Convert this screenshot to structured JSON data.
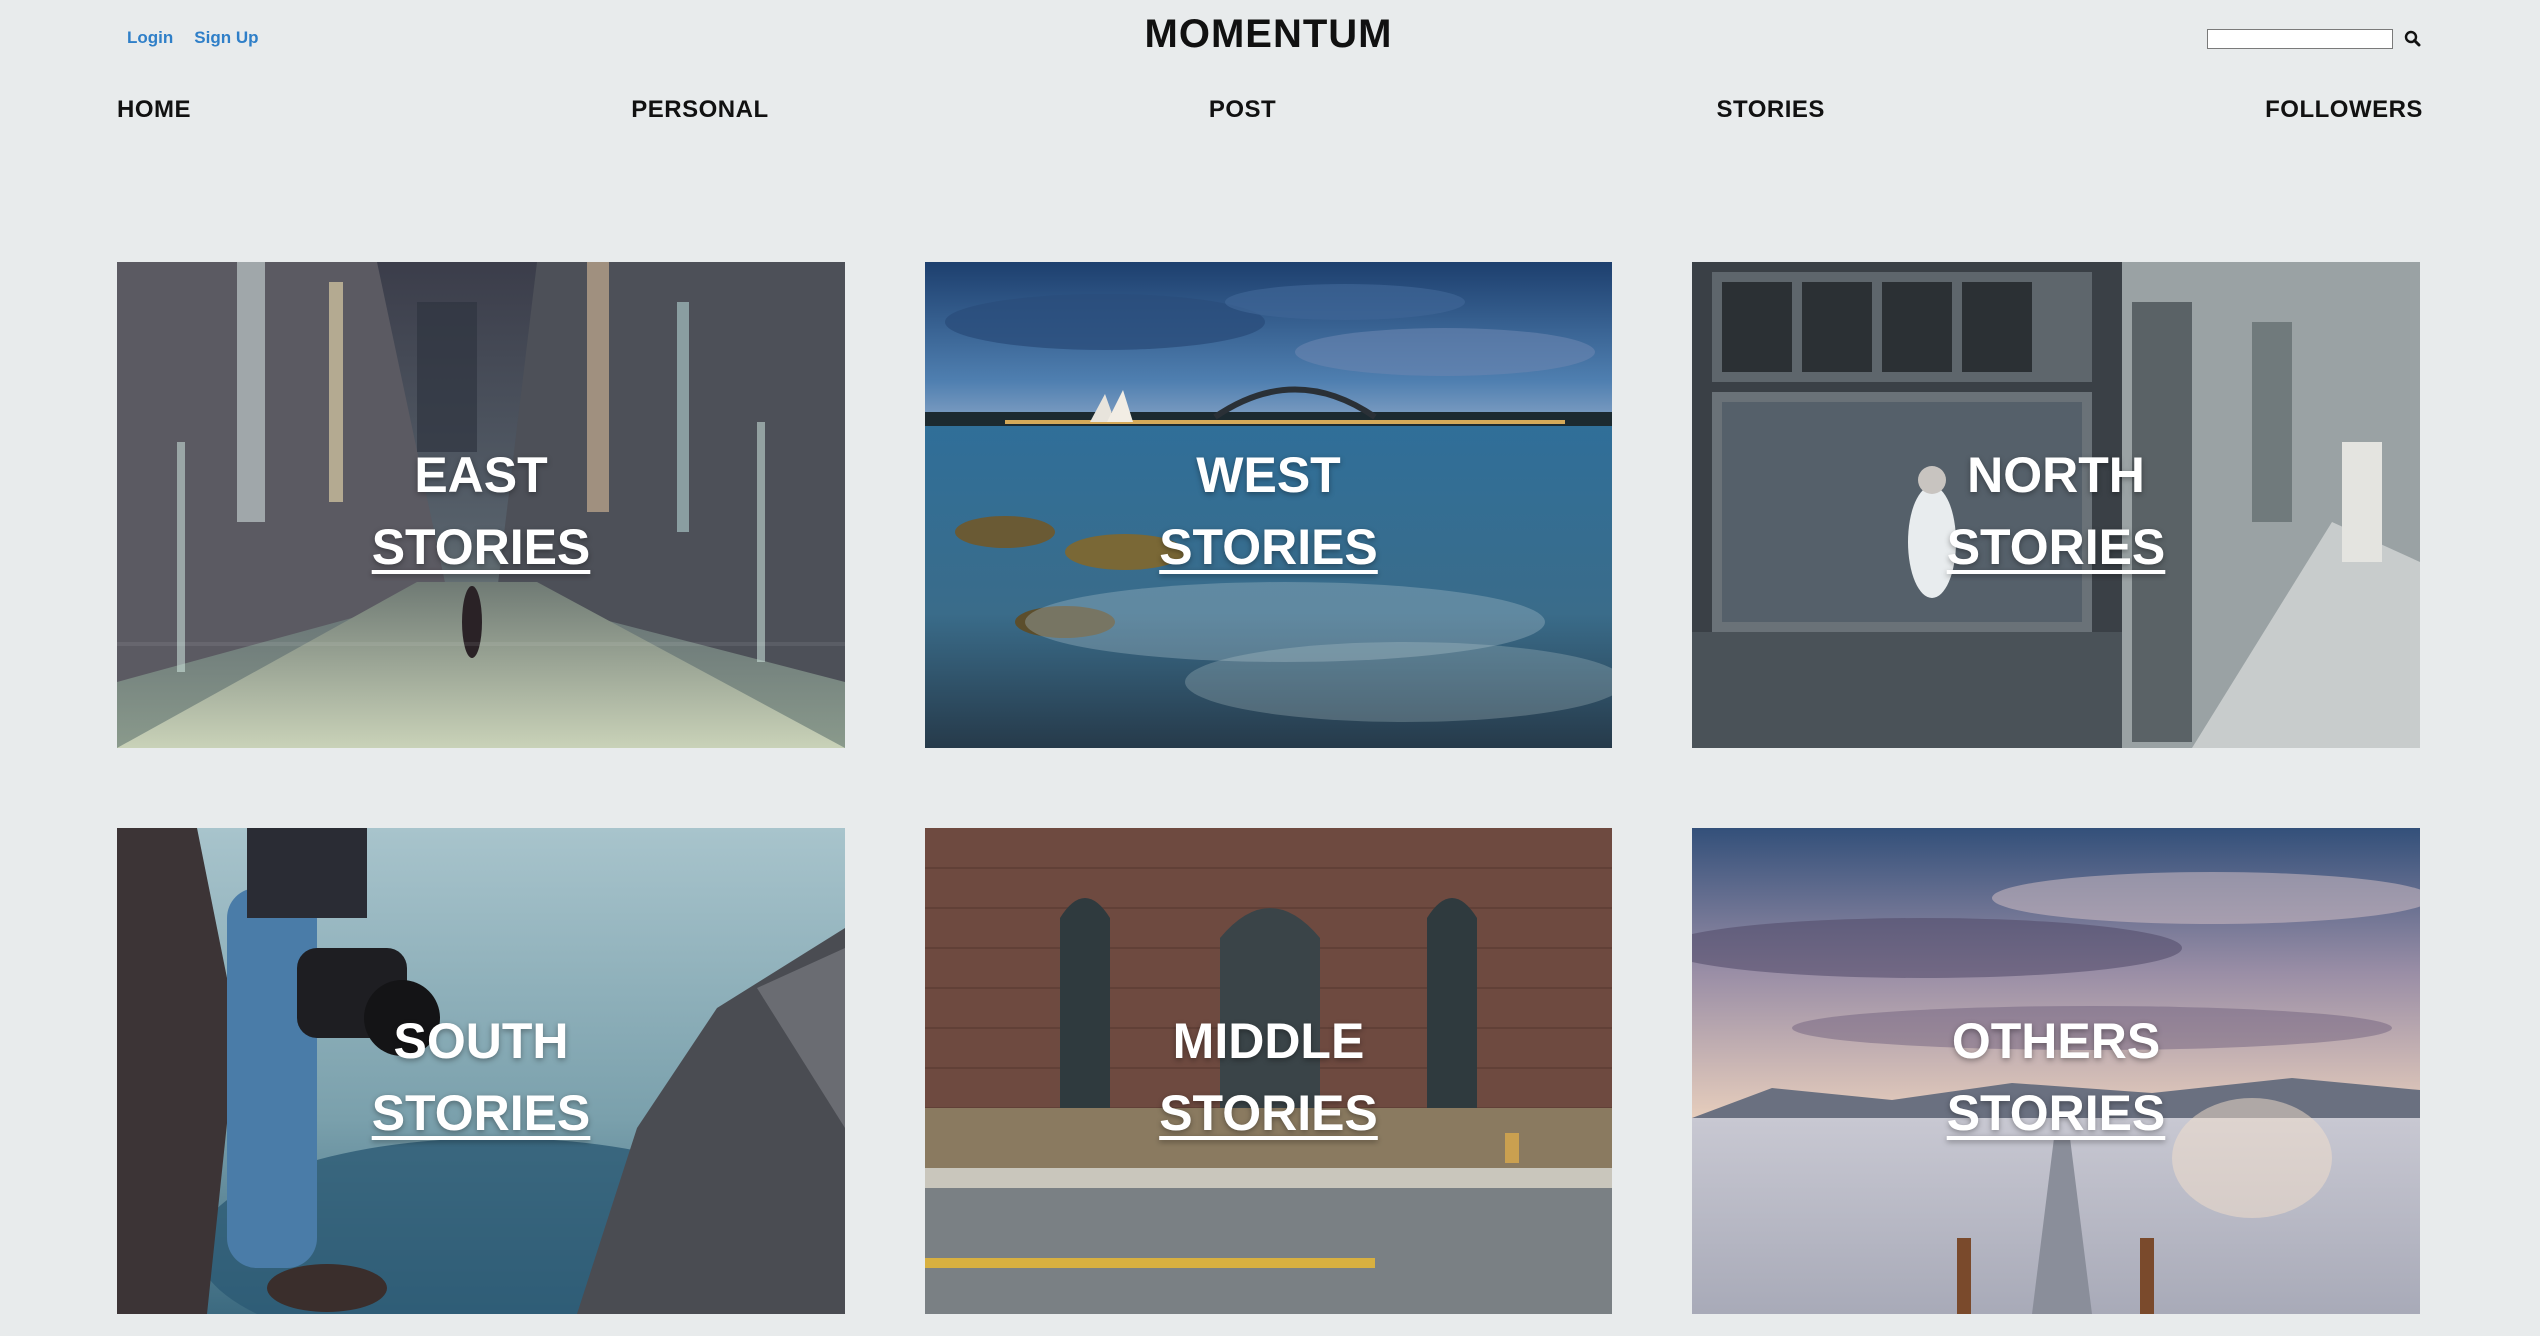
{
  "header": {
    "login_label": "Login",
    "signup_label": "Sign Up",
    "brand": "MOMENTUM",
    "search": {
      "value": "",
      "placeholder": "",
      "icon": "search-icon"
    }
  },
  "nav": {
    "items": [
      {
        "label": "HOME"
      },
      {
        "label": "PERSONAL"
      },
      {
        "label": "POST"
      },
      {
        "label": "STORIES"
      },
      {
        "label": "FOLLOWERS"
      }
    ]
  },
  "tiles": [
    {
      "line1": "EAST",
      "line2": "STORIES",
      "scene": "neon city street at night"
    },
    {
      "line1": "WEST",
      "line2": "STORIES",
      "scene": "harbour skyline at dusk over sea"
    },
    {
      "line1": "NORTH",
      "line2": "STORIES",
      "scene": "monochrome storefront on street"
    },
    {
      "line1": "SOUTH",
      "line2": "STORIES",
      "scene": "photographer on rocks with camera"
    },
    {
      "line1": "MIDDLE",
      "line2": "STORIES",
      "scene": "brick building with arched door"
    },
    {
      "line1": "OTHERS",
      "line2": "STORIES",
      "scene": "pier over calm lake at sunset"
    }
  ],
  "colors": {
    "background": "#e8ebec",
    "link": "#2f7fc8",
    "text": "#111111"
  }
}
